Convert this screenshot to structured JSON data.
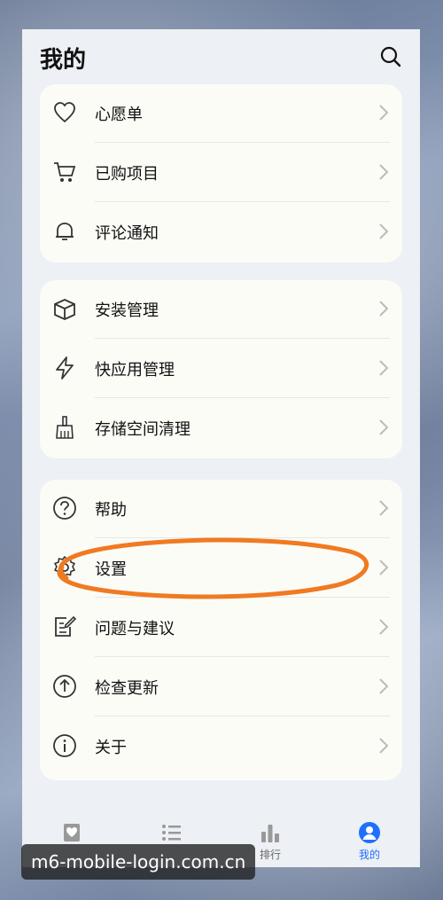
{
  "header": {
    "title": "我的"
  },
  "groups": [
    {
      "items": [
        {
          "label": "心愿单",
          "icon": "heart-icon"
        },
        {
          "label": "已购项目",
          "icon": "cart-icon"
        },
        {
          "label": "评论通知",
          "icon": "bell-icon"
        }
      ]
    },
    {
      "items": [
        {
          "label": "安装管理",
          "icon": "box-icon"
        },
        {
          "label": "快应用管理",
          "icon": "lightning-icon"
        },
        {
          "label": "存储空间清理",
          "icon": "broom-icon"
        }
      ]
    },
    {
      "items": [
        {
          "label": "帮助",
          "icon": "question-icon"
        },
        {
          "label": "设置",
          "icon": "gear-icon"
        },
        {
          "label": "问题与建议",
          "icon": "feedback-icon"
        },
        {
          "label": "检查更新",
          "icon": "upload-icon"
        },
        {
          "label": "关于",
          "icon": "info-icon"
        }
      ]
    }
  ],
  "tabbar": {
    "tabs": [
      {
        "label": "",
        "icon": "heart-icon"
      },
      {
        "label": "",
        "icon": "list-icon"
      },
      {
        "label": "排行",
        "icon": "bar-chart-icon"
      },
      {
        "label": "我的",
        "icon": "person-icon",
        "active": true
      }
    ]
  },
  "watermark": "m6-mobile-login.com.cn",
  "colors": {
    "accent": "#1f6fff",
    "annotation": "#f07a22"
  }
}
